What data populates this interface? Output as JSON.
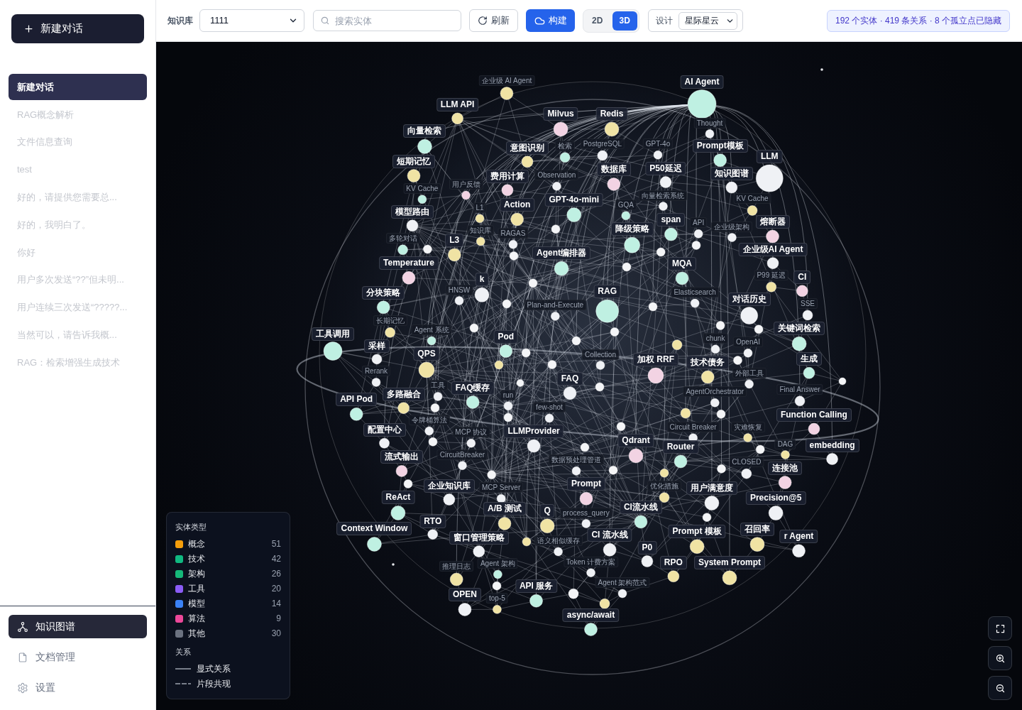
{
  "sidebar": {
    "new_chat_button": "新建对话",
    "conversations": [
      {
        "title": "新建对话",
        "selected": true
      },
      {
        "title": "RAG概念解析",
        "selected": false
      },
      {
        "title": "文件信息查询",
        "selected": false
      },
      {
        "title": "test",
        "selected": false
      },
      {
        "title": "好的，请提供您需要总...",
        "selected": false
      },
      {
        "title": "好的，我明白了。",
        "selected": false
      },
      {
        "title": "你好",
        "selected": false
      },
      {
        "title": "用户多次发送“??”但未明...",
        "selected": false
      },
      {
        "title": "用户连续三次发送“?????...",
        "selected": false
      },
      {
        "title": "当然可以，请告诉我概...",
        "selected": false
      },
      {
        "title": "RAG：检索增强生成技术",
        "selected": false
      }
    ],
    "nav": [
      {
        "label": "知识图谱",
        "selected": true
      },
      {
        "label": "文档管理",
        "selected": false
      },
      {
        "label": "设置",
        "selected": false
      }
    ]
  },
  "toolbar": {
    "knowledge_base_label": "知识库",
    "knowledge_base_select": {
      "value": "1111"
    },
    "search": {
      "placeholder": "搜索实体"
    },
    "refresh_button": "刷新",
    "build_button": "构建",
    "view_modes": [
      {
        "label": "2D",
        "selected": false
      },
      {
        "label": "3D",
        "selected": true
      }
    ],
    "design_label": "设计",
    "design_select": {
      "value": "星际星云"
    },
    "stats": "192 个实体 · 419 条关系 · 8 个孤立点已隐藏"
  },
  "graph": {
    "nodes": [
      {
        "label": "AI Agent",
        "color": "#bff0e2",
        "dim": false
      },
      {
        "label": "Milvus",
        "color": "#f2d3e3",
        "dim": false
      },
      {
        "label": "企业级 AI Agent",
        "color": "#f0e3a4",
        "dim": true
      },
      {
        "label": "Redis",
        "color": "#f0e3a4",
        "dim": false
      },
      {
        "label": "意图识别",
        "color": "#f0e3a4",
        "dim": false
      },
      {
        "label": "检索",
        "color": "#bff0e2",
        "dim": true
      },
      {
        "label": "PostgreSQL",
        "color": "#eff1f5",
        "dim": true
      },
      {
        "label": "数据库",
        "color": "#f2d3e3",
        "dim": false
      },
      {
        "label": "GPT-4o",
        "color": "#eff1f5",
        "dim": true
      },
      {
        "label": "P50延迟",
        "color": "#eff1f5",
        "dim": false
      },
      {
        "label": "Thought",
        "color": "#eff1f5",
        "dim": true
      },
      {
        "label": "LLM API",
        "color": "#f0e3a4",
        "dim": false
      },
      {
        "label": "用户反馈",
        "color": "#f2d3e3",
        "dim": true
      },
      {
        "label": "费用计算",
        "color": "#f2d3e3",
        "dim": false
      },
      {
        "label": "Observation",
        "color": "#eff1f5",
        "dim": true
      },
      {
        "label": "GPT-4o-mini",
        "color": "#bff0e2",
        "dim": false
      },
      {
        "label": "Prompt模板",
        "color": "#bff0e2",
        "dim": false
      },
      {
        "label": "向量检索",
        "color": "#bff0e2",
        "dim": false
      },
      {
        "label": "向量检索系统",
        "color": "#eff1f5",
        "dim": true
      },
      {
        "label": "L1",
        "color": "#f0e3a4",
        "dim": true
      },
      {
        "label": "GQA",
        "color": "#bff0e2",
        "dim": true
      },
      {
        "label": "知识图谱",
        "color": "#eff1f5",
        "dim": false
      },
      {
        "label": "LLM",
        "color": "#eff1f5",
        "dim": false
      },
      {
        "label": "Action",
        "color": "#f0e3a4",
        "dim": false
      },
      {
        "label": "短期记忆",
        "color": "#f0e3a4",
        "dim": false
      },
      {
        "label": "知识库",
        "color": "#f0e3a4",
        "dim": true
      },
      {
        "label": "span",
        "color": "#bff0e2",
        "dim": false
      },
      {
        "label": "KV Cache",
        "color": "#f0e3a4",
        "dim": true
      },
      {
        "label": "KV Cache",
        "color": "#bff0e2",
        "dim": true
      },
      {
        "label": "RAGAS",
        "color": "#eff1f5",
        "dim": true
      },
      {
        "label": "降级策略",
        "color": "#bff0e2",
        "dim": false
      },
      {
        "label": "API",
        "color": "#eff1f5",
        "dim": true
      },
      {
        "label": "熔断器",
        "color": "#f2d3e3",
        "dim": false
      },
      {
        "label": "L3",
        "color": "#f0e3a4",
        "dim": false
      },
      {
        "label": "模型路由",
        "color": "#eff1f5",
        "dim": false
      },
      {
        "label": "企业级架构",
        "color": "#eff1f5",
        "dim": true
      },
      {
        "label": "Agent编排器",
        "color": "#bff0e2",
        "dim": false
      },
      {
        "label": "企业级AI Agent",
        "color": "#eff1f5",
        "dim": false
      },
      {
        "label": "多轮对话",
        "color": "#bff0e2",
        "dim": true
      },
      {
        "label": "k",
        "color": "#eff1f5",
        "dim": false
      },
      {
        "label": "Temperature",
        "color": "#f2d3e3",
        "dim": false
      },
      {
        "label": "HNSW",
        "color": "#eff1f5",
        "dim": true
      },
      {
        "label": "MQA",
        "color": "#bff0e2",
        "dim": false
      },
      {
        "label": "P99 延迟",
        "color": "#f0e3a4",
        "dim": true
      },
      {
        "label": "分块策略",
        "color": "#bff0e2",
        "dim": false
      },
      {
        "label": "RAG",
        "color": "#bff0e2",
        "dim": false
      },
      {
        "label": "Plan-and-Execute",
        "color": "#eff1f5",
        "dim": true
      },
      {
        "label": "对话历史",
        "color": "#eff1f5",
        "dim": false
      },
      {
        "label": "CI",
        "color": "#f2d3e3",
        "dim": false
      },
      {
        "label": "SSE",
        "color": "#eff1f5",
        "dim": true
      },
      {
        "label": "Elasticsearch",
        "color": "#eff1f5",
        "dim": true
      },
      {
        "label": "工具调用",
        "color": "#bff0e2",
        "dim": false
      },
      {
        "label": "长期记忆",
        "color": "#f0e3a4",
        "dim": true
      },
      {
        "label": "Agent 系统",
        "color": "#bff0e2",
        "dim": true
      },
      {
        "label": "Pod",
        "color": "#bff0e2",
        "dim": false
      },
      {
        "label": "关键词检索",
        "color": "#bff0e2",
        "dim": false
      },
      {
        "label": "采样",
        "color": "#eff1f5",
        "dim": false
      },
      {
        "label": "QPS",
        "color": "#f0e3a4",
        "dim": false
      },
      {
        "label": "加权 RRF",
        "color": "#f2d3e3",
        "dim": false
      },
      {
        "label": "生成",
        "color": "#bff0e2",
        "dim": false
      },
      {
        "label": "Rerank",
        "color": "#eff1f5",
        "dim": true
      },
      {
        "label": "Collection",
        "color": "#eff1f5",
        "dim": true
      },
      {
        "label": "chunk",
        "color": "#eff1f5",
        "dim": true
      },
      {
        "label": "OpenAI",
        "color": "#eff1f5",
        "dim": true
      },
      {
        "label": "技术债务",
        "color": "#f0e3a4",
        "dim": false
      },
      {
        "label": "embedding",
        "color": "#eff1f5",
        "dim": false
      },
      {
        "label": "API Pod",
        "color": "#bff0e2",
        "dim": false
      },
      {
        "label": "FAQ缓存",
        "color": "#bff0e2",
        "dim": false
      },
      {
        "label": "FAQ",
        "color": "#eff1f5",
        "dim": false
      },
      {
        "label": "Final Answer",
        "color": "#eff1f5",
        "dim": true
      },
      {
        "label": "DAG",
        "color": "#f0e3a4",
        "dim": true
      },
      {
        "label": "外部工具",
        "color": "#eff1f5",
        "dim": true
      },
      {
        "label": "多路融合",
        "color": "#f0e3a4",
        "dim": false
      },
      {
        "label": "工具",
        "color": "#eff1f5",
        "dim": true
      },
      {
        "label": "AgentOrchestrator",
        "color": "#eff1f5",
        "dim": true
      },
      {
        "label": "Precision@5",
        "color": "#eff1f5",
        "dim": false
      },
      {
        "label": "Function Calling",
        "color": "#f2d3e3",
        "dim": false
      },
      {
        "label": "配置中心",
        "color": "#eff1f5",
        "dim": false
      },
      {
        "label": "MCP 协议",
        "color": "#eff1f5",
        "dim": true
      },
      {
        "label": "令牌桶算法",
        "color": "#eff1f5",
        "dim": true
      },
      {
        "label": "run",
        "color": "#eff1f5",
        "dim": true
      },
      {
        "label": "few-shot",
        "color": "#eff1f5",
        "dim": true
      },
      {
        "label": "流式输出",
        "color": "#f2d3e3",
        "dim": false
      },
      {
        "label": "灾难恢复",
        "color": "#f0e3a4",
        "dim": true
      },
      {
        "label": "连接池",
        "color": "#f2d3e3",
        "dim": false
      },
      {
        "label": "Qdrant",
        "color": "#f2d3e3",
        "dim": false
      },
      {
        "label": "Circuit Breaker",
        "color": "#eff1f5",
        "dim": true
      },
      {
        "label": "CLOSED",
        "color": "#eff1f5",
        "dim": true
      },
      {
        "label": "ReAct",
        "color": "#bff0e2",
        "dim": false
      },
      {
        "label": "CircuitBreaker",
        "color": "#eff1f5",
        "dim": true
      },
      {
        "label": "LLMProvider",
        "color": "#eff1f5",
        "dim": false
      },
      {
        "label": "MCP Server",
        "color": "#eff1f5",
        "dim": true
      },
      {
        "label": "Router",
        "color": "#bff0e2",
        "dim": false
      },
      {
        "label": "优化措施",
        "color": "#f0e3a4",
        "dim": true
      },
      {
        "label": "数据预处理管道",
        "color": "#eff1f5",
        "dim": true
      },
      {
        "label": "Context Window",
        "color": "#bff0e2",
        "dim": false
      },
      {
        "label": "企业知识库",
        "color": "#eff1f5",
        "dim": false
      },
      {
        "label": "用户满意度",
        "color": "#eff1f5",
        "dim": false
      },
      {
        "label": "召回率",
        "color": "#f0e3a4",
        "dim": false
      },
      {
        "label": "r Agent",
        "color": "#eff1f5",
        "dim": false
      },
      {
        "label": "RTO",
        "color": "#eff1f5",
        "dim": false
      },
      {
        "label": "A/B 测试",
        "color": "#f0e3a4",
        "dim": false
      },
      {
        "label": "Prompt",
        "color": "#f2d3e3",
        "dim": false
      },
      {
        "label": "CI流水线",
        "color": "#bff0e2",
        "dim": false
      },
      {
        "label": "窗口管理策略",
        "color": "#eff1f5",
        "dim": false
      },
      {
        "label": "推理日志",
        "color": "#f0e3a4",
        "dim": true
      },
      {
        "label": "Agent 架构",
        "color": "#bff0e2",
        "dim": true
      },
      {
        "label": "Q",
        "color": "#f0e3a4",
        "dim": false
      },
      {
        "label": "process_query",
        "color": "#eff1f5",
        "dim": true
      },
      {
        "label": "CI 流水线",
        "color": "#eff1f5",
        "dim": false
      },
      {
        "label": "Prompt 模板",
        "color": "#f0e3a4",
        "dim": false
      },
      {
        "label": "P0",
        "color": "#eff1f5",
        "dim": false
      },
      {
        "label": "RPO",
        "color": "#f0e3a4",
        "dim": false
      },
      {
        "label": "System Prompt",
        "color": "#f0e3a4",
        "dim": false
      },
      {
        "label": "top-5",
        "color": "#f0e3a4",
        "dim": true
      },
      {
        "label": "Token 计费方案",
        "color": "#eff1f5",
        "dim": true
      },
      {
        "label": "OPEN",
        "color": "#eff1f5",
        "dim": false
      },
      {
        "label": "API 服务",
        "color": "#bff0e2",
        "dim": false
      },
      {
        "label": "语义相似缓存",
        "color": "#eff1f5",
        "dim": true
      },
      {
        "label": "Agent 架构范式",
        "color": "#eff1f5",
        "dim": true
      },
      {
        "label": "async/await",
        "color": "#bff0e2",
        "dim": false
      },
      {
        "color": "#f4f5f7"
      },
      {
        "color": "#f4f5f7"
      },
      {
        "color": "#f4f5f7"
      },
      {
        "color": "#f4f5f7"
      },
      {
        "color": "#f4f5f7"
      },
      {
        "color": "#f4f5f7"
      },
      {
        "color": "#f4f5f7"
      },
      {
        "color": "#f4f5f7"
      },
      {
        "color": "#f4f5f7"
      },
      {
        "color": "#f0e3a4"
      },
      {
        "color": "#f4f5f7"
      },
      {
        "color": "#f4f5f7"
      },
      {
        "color": "#f4f5f7"
      },
      {
        "color": "#f0e3a4"
      },
      {
        "color": "#f4f5f7"
      },
      {
        "color": "#f4f5f7"
      },
      {
        "color": "#f4f5f7"
      },
      {
        "color": "#f4f5f7"
      },
      {
        "color": "#f4f5f7"
      },
      {
        "color": "#f4f5f7"
      },
      {
        "color": "#f0e3a4"
      },
      {
        "color": "#f4f5f7"
      },
      {
        "color": "#f4f5f7"
      },
      {
        "color": "#f4f5f7"
      },
      {
        "color": "#f4f5f7"
      },
      {
        "color": "#f0e3a4"
      },
      {
        "color": "#f4f5f7"
      },
      {
        "color": "#f4f5f7"
      },
      {
        "color": "#f4f5f7"
      },
      {
        "color": "#f4f5f7"
      },
      {
        "color": "#f4f5f7"
      },
      {
        "color": "#f4f5f7"
      },
      {
        "color": "#f0e3a4"
      },
      {
        "color": "#f4f5f7"
      },
      {
        "color": "#f0e3a4"
      },
      {
        "color": "#f4f5f7"
      },
      {
        "color": "#f4f5f7"
      },
      {
        "color": "#f4f5f7"
      },
      {
        "color": "#f4f5f7"
      },
      {
        "color": "#f4f5f7"
      }
    ],
    "legend": {
      "title": "实体类型",
      "types": [
        {
          "name": "概念",
          "count": "51",
          "color": "#f59e0b"
        },
        {
          "name": "技术",
          "count": "42",
          "color": "#10b981"
        },
        {
          "name": "架构",
          "count": "26",
          "color": "#16b879"
        },
        {
          "name": "工具",
          "count": "20",
          "color": "#8b5cf6"
        },
        {
          "name": "模型",
          "count": "14",
          "color": "#3b82f6"
        },
        {
          "name": "算法",
          "count": "9",
          "color": "#ec4899"
        },
        {
          "name": "其他",
          "count": "30",
          "color": "#6b7280"
        }
      ],
      "relations_title": "关系",
      "relations": [
        {
          "label": "显式关系",
          "kind": "solid"
        },
        {
          "label": "片段共现",
          "kind": "dashed"
        }
      ]
    }
  }
}
